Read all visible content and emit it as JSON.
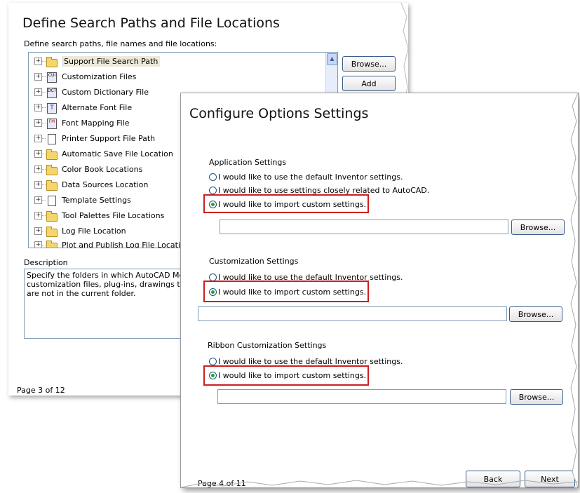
{
  "back_dialog": {
    "title": "Define Search Paths and File Locations",
    "subtitle": "Define search paths, file names and file locations:",
    "tree_items": [
      {
        "label": "Support File Search Path",
        "icon": "folder-icon",
        "selected": true
      },
      {
        "label": "Customization Files",
        "icon": "customization-file-icon"
      },
      {
        "label": "Custom Dictionary File",
        "icon": "dictionary-file-icon"
      },
      {
        "label": "Alternate Font File",
        "icon": "font-file-icon"
      },
      {
        "label": "Font Mapping File",
        "icon": "font-mapping-icon"
      },
      {
        "label": "Printer Support File Path",
        "icon": "document-icon"
      },
      {
        "label": "Automatic Save File Location",
        "icon": "folder-icon"
      },
      {
        "label": "Color Book Locations",
        "icon": "folder-icon"
      },
      {
        "label": "Data Sources Location",
        "icon": "folder-icon"
      },
      {
        "label": "Template Settings",
        "icon": "document-icon"
      },
      {
        "label": "Tool Palettes File Locations",
        "icon": "folder-icon"
      },
      {
        "label": "Log File Location",
        "icon": "folder-icon"
      },
      {
        "label": "Plot and Publish Log File Location",
        "icon": "folder-icon"
      }
    ],
    "browse_label": "Browse...",
    "add_label": "Add",
    "description_label": "Description",
    "description_text": "Specify the folders in which AutoCAD Mech\ncustomization files, plug-ins, drawings to in\nare not in the current folder.",
    "page_label": "Page 3 of 12"
  },
  "front_dialog": {
    "title": "Configure Options Settings",
    "sections": [
      {
        "heading": "Application Settings",
        "options": [
          {
            "label": "I would like to use the default Inventor settings.",
            "selected": false
          },
          {
            "label": "I would like to use settings closely related to AutoCAD.",
            "selected": false
          },
          {
            "label": "I would like to import custom settings.",
            "selected": true
          }
        ],
        "path_value": "",
        "browse_label": "Browse..."
      },
      {
        "heading": "Customization Settings",
        "options": [
          {
            "label": "I would like to use the default Inventor settings.",
            "selected": false
          },
          {
            "label": "I would like to import custom settings.",
            "selected": true
          }
        ],
        "path_value": "",
        "browse_label": "Browse..."
      },
      {
        "heading": "Ribbon Customization Settings",
        "options": [
          {
            "label": "I would like to use the default Inventor settings.",
            "selected": false
          },
          {
            "label": "I would like to import custom settings.",
            "selected": true
          }
        ],
        "path_value": "",
        "browse_label": "Browse..."
      }
    ],
    "page_label": "Page 4 of 11",
    "back_label": "Back",
    "next_label": "Next"
  },
  "colors": {
    "highlight_box": "#cc1f1f",
    "radio_selected": "#22a822",
    "field_border": "#7f9db9"
  }
}
